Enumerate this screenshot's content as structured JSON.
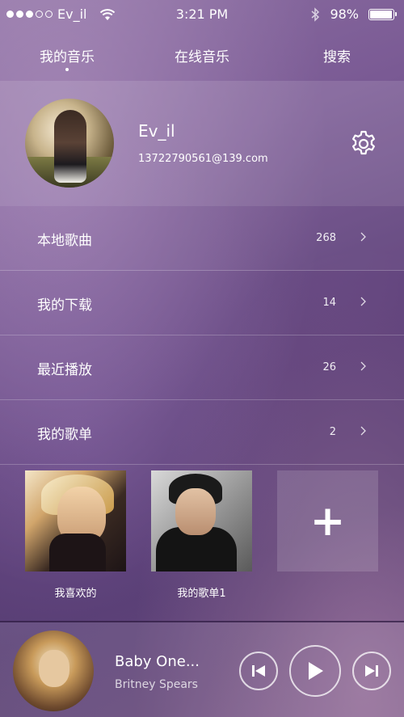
{
  "status_bar": {
    "signal_filled": 3,
    "signal_total": 5,
    "carrier": "Ev_il",
    "time": "3:21 PM",
    "battery_text": "98%",
    "battery_level": 0.98
  },
  "tabs": [
    {
      "label": "我的音乐",
      "active": true
    },
    {
      "label": "在线音乐",
      "active": false
    },
    {
      "label": "搜索",
      "active": false
    }
  ],
  "profile": {
    "username": "Ev_il",
    "email": "13722790561@139.com"
  },
  "menu": [
    {
      "label": "本地歌曲",
      "count": "268"
    },
    {
      "label": "我的下载",
      "count": "14"
    },
    {
      "label": "最近播放",
      "count": "26"
    },
    {
      "label": "我的歌单",
      "count": "2"
    }
  ],
  "playlists": [
    {
      "label": "我喜欢的"
    },
    {
      "label": "我的歌单1"
    }
  ],
  "add_playlist_symbol": "+",
  "now_playing": {
    "title": "Baby One...",
    "artist": "Britney Spears"
  },
  "icons": {
    "settings": "gear-icon",
    "chevron": "chevron-right-icon",
    "prev": "skip-previous-icon",
    "play": "play-icon",
    "next": "skip-next-icon",
    "bluetooth": "bluetooth-icon",
    "wifi": "wifi-icon"
  }
}
